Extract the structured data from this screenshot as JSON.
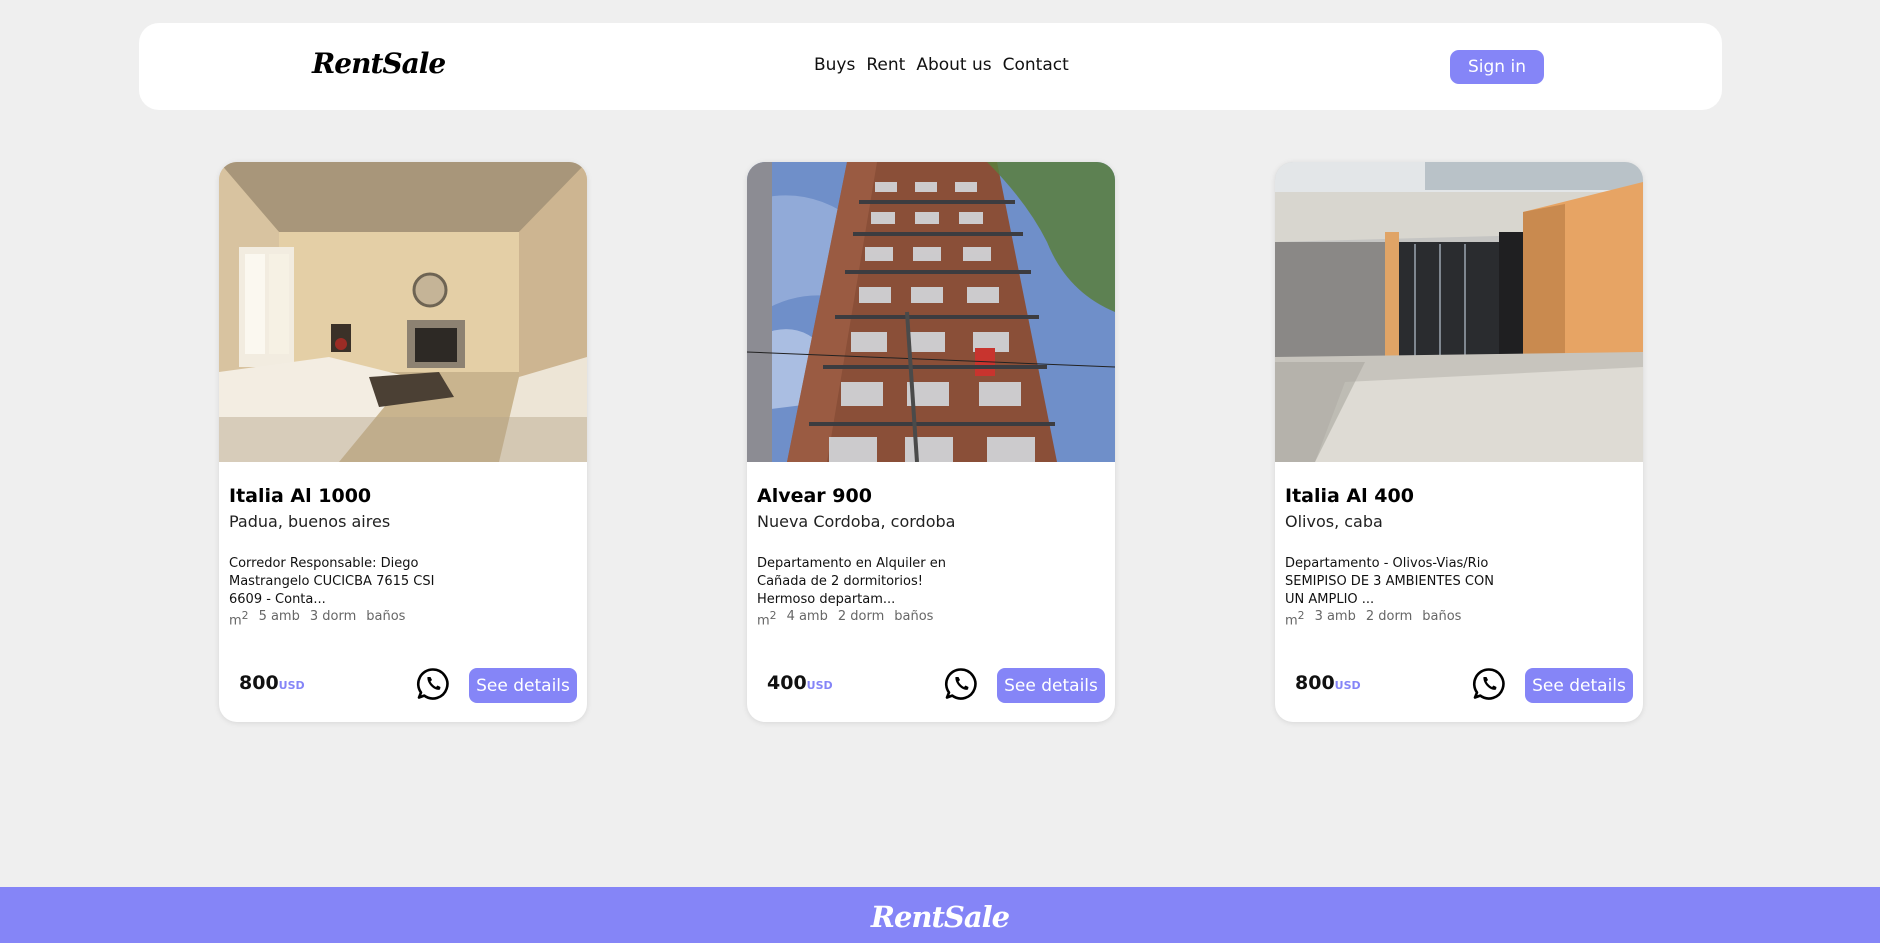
{
  "brand": {
    "name": "RentSale",
    "accent_color": "#8585f7"
  },
  "nav": {
    "items": [
      "Buys",
      "Rent",
      "About us",
      "Contact"
    ],
    "sign_in": "Sign in"
  },
  "listings": [
    {
      "title": "Italia Al 1000",
      "location": "Padua, buenos aires",
      "description": "Corredor Responsable: Diego Mastrangelo CUCICBA 7615 CSI 6609 - Conta...",
      "area_unit": "m",
      "area_sup": "2",
      "rooms": "5 amb",
      "bedrooms": "3 dorm",
      "bathrooms": "baños",
      "price": "800",
      "currency": "USD",
      "photo": "living-room",
      "whatsapp_icon": "whatsapp-icon",
      "details_label": "See details"
    },
    {
      "title": "Alvear 900",
      "location": "Nueva Cordoba, cordoba",
      "description": "Departamento en Alquiler en Cañada de 2 dormitorios! Hermoso departam...",
      "area_unit": "m",
      "area_sup": "2",
      "rooms": "4 amb",
      "bedrooms": "2 dorm",
      "bathrooms": "baños",
      "price": "400",
      "currency": "USD",
      "photo": "apartment-tower",
      "whatsapp_icon": "whatsapp-icon",
      "details_label": "See details"
    },
    {
      "title": "Italia Al 400",
      "location": "Olivos, caba",
      "description": "Departamento - Olivos-Vias/Rio SEMIPISO DE 3 AMBIENTES CON UN AMPLIO ...",
      "area_unit": "m",
      "area_sup": "2",
      "rooms": "3 amb",
      "bedrooms": "2 dorm",
      "bathrooms": "baños",
      "price": "800",
      "currency": "USD",
      "photo": "building-entrance",
      "whatsapp_icon": "whatsapp-icon",
      "details_label": "See details"
    }
  ],
  "footer": {
    "logo": "RentSale"
  }
}
